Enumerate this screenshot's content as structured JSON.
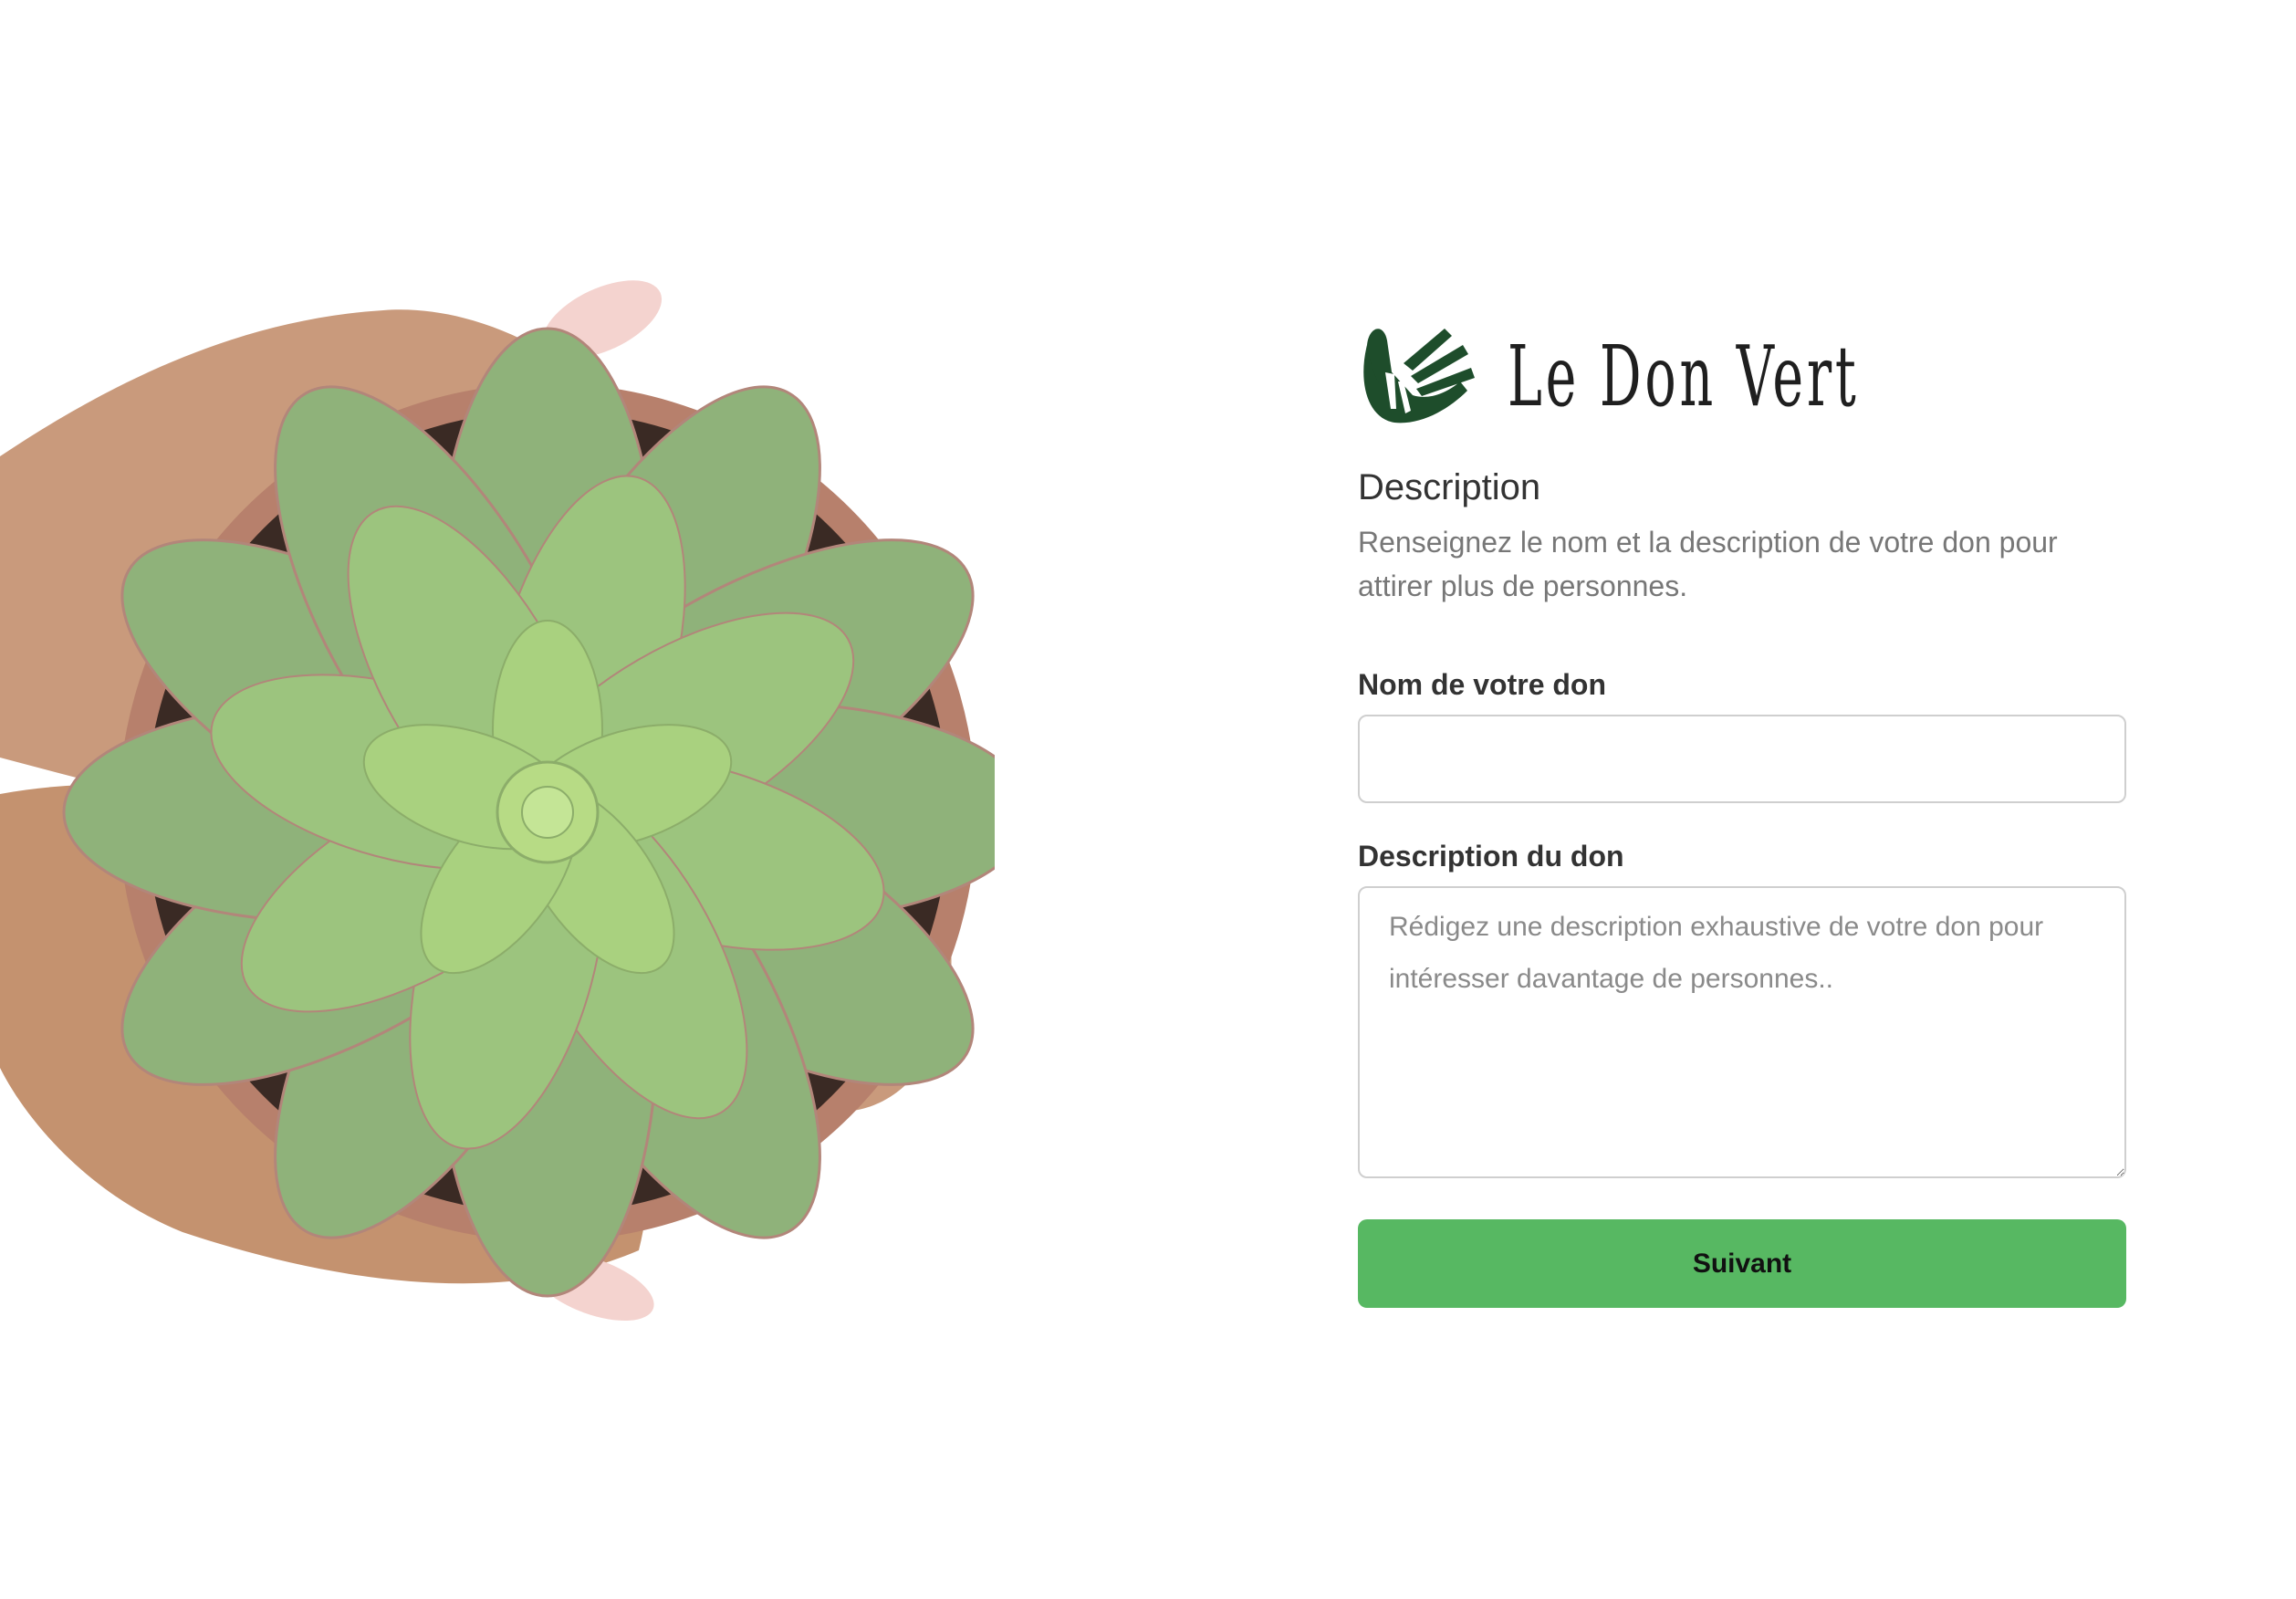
{
  "brand": {
    "name": "Le Don Vert",
    "logo_icon": "hands-leaf-icon",
    "logo_color": "#1e4d2b"
  },
  "hero": {
    "image": "succulent-in-hands-illustration"
  },
  "section": {
    "title": "Description",
    "description": "Renseignez le nom et la description de votre don pour attirer plus de personnes."
  },
  "form": {
    "name_label": "Nom de votre don",
    "name_value": "",
    "name_placeholder": "",
    "description_label": "Description du don",
    "description_value": "",
    "description_placeholder": "Rédigez une description exhaustive de votre don pour intéresser davantage de personnes.."
  },
  "actions": {
    "next_label": "Suivant",
    "next_color": "#57b862"
  }
}
